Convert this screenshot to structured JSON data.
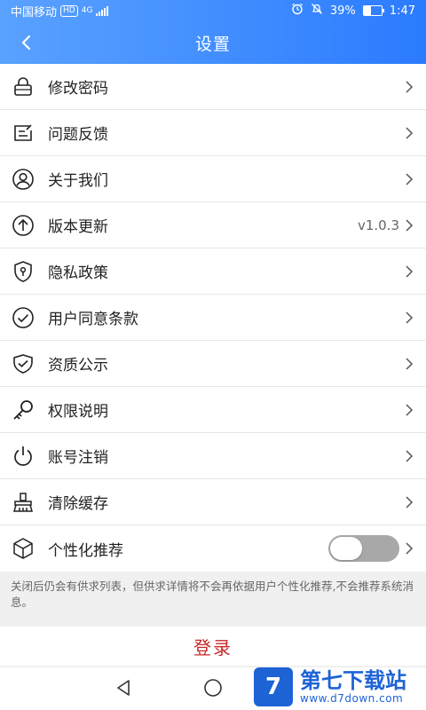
{
  "status": {
    "carrier": "中国移动",
    "hd": "HD",
    "network": "4G",
    "battery": "39%",
    "battery_level": 0.39,
    "time": "1:47"
  },
  "header": {
    "title": "设置"
  },
  "menu": {
    "items": [
      {
        "label": "修改密码",
        "icon": "lock-icon"
      },
      {
        "label": "问题反馈",
        "icon": "feedback-icon"
      },
      {
        "label": "关于我们",
        "icon": "user-icon"
      },
      {
        "label": "版本更新",
        "icon": "upload-arrow-icon",
        "value": "v1.0.3"
      },
      {
        "label": "隐私政策",
        "icon": "shield-lock-icon"
      },
      {
        "label": "用户同意条款",
        "icon": "check-circle-icon"
      },
      {
        "label": "资质公示",
        "icon": "shield-check-icon"
      },
      {
        "label": "权限说明",
        "icon": "key-icon"
      },
      {
        "label": "账号注销",
        "icon": "power-icon"
      },
      {
        "label": "清除缓存",
        "icon": "broom-icon"
      },
      {
        "label": "个性化推荐",
        "icon": "cube-icon",
        "toggle_on": false
      }
    ]
  },
  "note": "关闭后仍会有供求列表，但供求详情将不会再依据用户个性化推荐,不会推荐系统消息。",
  "login_label": "登录",
  "watermark": {
    "logo": "7",
    "title": "第七下载站",
    "url": "www.d7down.com"
  },
  "colors": {
    "header_start": "#5aa2ff",
    "header_end": "#2b7bff",
    "login_text": "#c62828",
    "watermark": "#1d63d6"
  }
}
